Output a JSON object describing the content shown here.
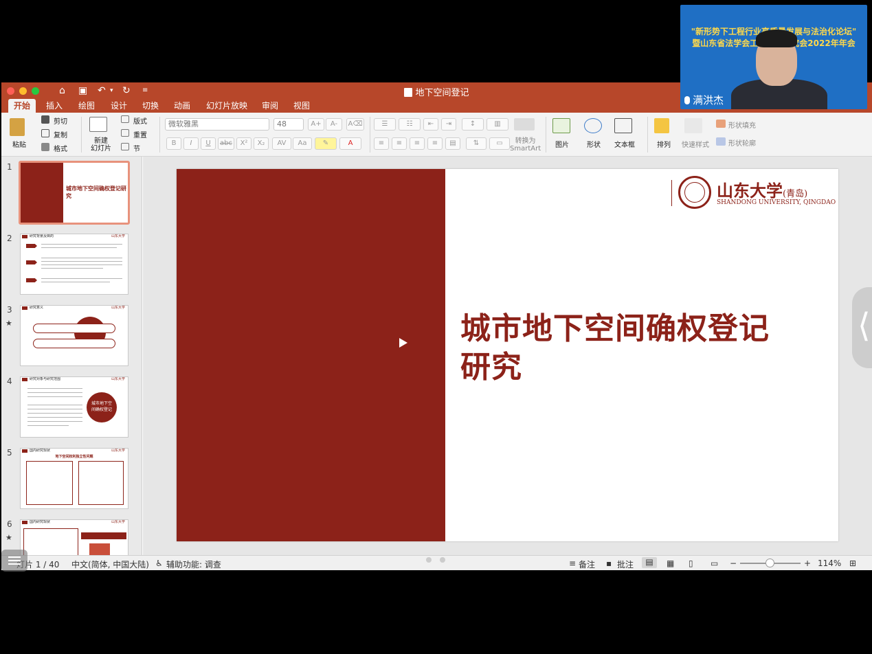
{
  "window": {
    "title": "地下空间登记"
  },
  "tabs": [
    {
      "label": "开始",
      "active": true
    },
    {
      "label": "插入"
    },
    {
      "label": "绘图"
    },
    {
      "label": "设计"
    },
    {
      "label": "切换"
    },
    {
      "label": "动画"
    },
    {
      "label": "幻灯片放映"
    },
    {
      "label": "审阅"
    },
    {
      "label": "视图"
    }
  ],
  "ribbon": {
    "paste": "粘贴",
    "cut": "剪切",
    "copy": "复制",
    "format": "格式",
    "new_slide": "新建\n幻灯片",
    "layout": "版式",
    "reset": "重置",
    "section": "节",
    "font_name": "微软雅黑",
    "font_size": "48",
    "convert_smartart": "转换为\nSmartArt",
    "picture": "图片",
    "shape": "形状",
    "textbox": "文本框",
    "arrange": "排列",
    "quick_styles": "快速样式",
    "shape_fill": "形状填充",
    "shape_outline": "形状轮廓",
    "format_buttons": [
      "B",
      "I",
      "U",
      "abc",
      "X²",
      "X₂"
    ]
  },
  "thumbnails": [
    {
      "number": "1",
      "title": "城市地下空间确权登记研究",
      "selected": true
    },
    {
      "number": "2",
      "heading": "研究背景及目的"
    },
    {
      "number": "3",
      "heading": "研究意义",
      "star": "★"
    },
    {
      "number": "4",
      "heading": "研究对象与研究范围",
      "circle_text": "城市地下空\n间确权登记"
    },
    {
      "number": "5",
      "heading": "国内研究现状",
      "subheading": "地下空间权利独立性问题"
    },
    {
      "number": "6",
      "heading": "国内研究现状",
      "star": "★"
    }
  ],
  "slide": {
    "title": "城市地下空间确权登记研究",
    "title_line1": "城市地下空间确权登记",
    "title_line2": "研究",
    "logo_cn": "山东大学",
    "logo_cn_suffix": "(青岛)",
    "logo_en": "SHANDONG UNIVERSITY, QINGDAO",
    "accent_color": "#8c2219"
  },
  "statusbar": {
    "slide_counter": "灯片 1 / 40",
    "language": "中文(简体, 中国大陆)",
    "accessibility": "辅助功能: 调查",
    "notes": "备注",
    "comments": "批注",
    "zoom": "114%"
  },
  "video": {
    "banner1": "\"新形势下工程行业高质量发展与法治化论坛\"",
    "banner2": "暨山东省法学会工程法学研究会2022年年会",
    "participant_name": "满洪杰"
  }
}
